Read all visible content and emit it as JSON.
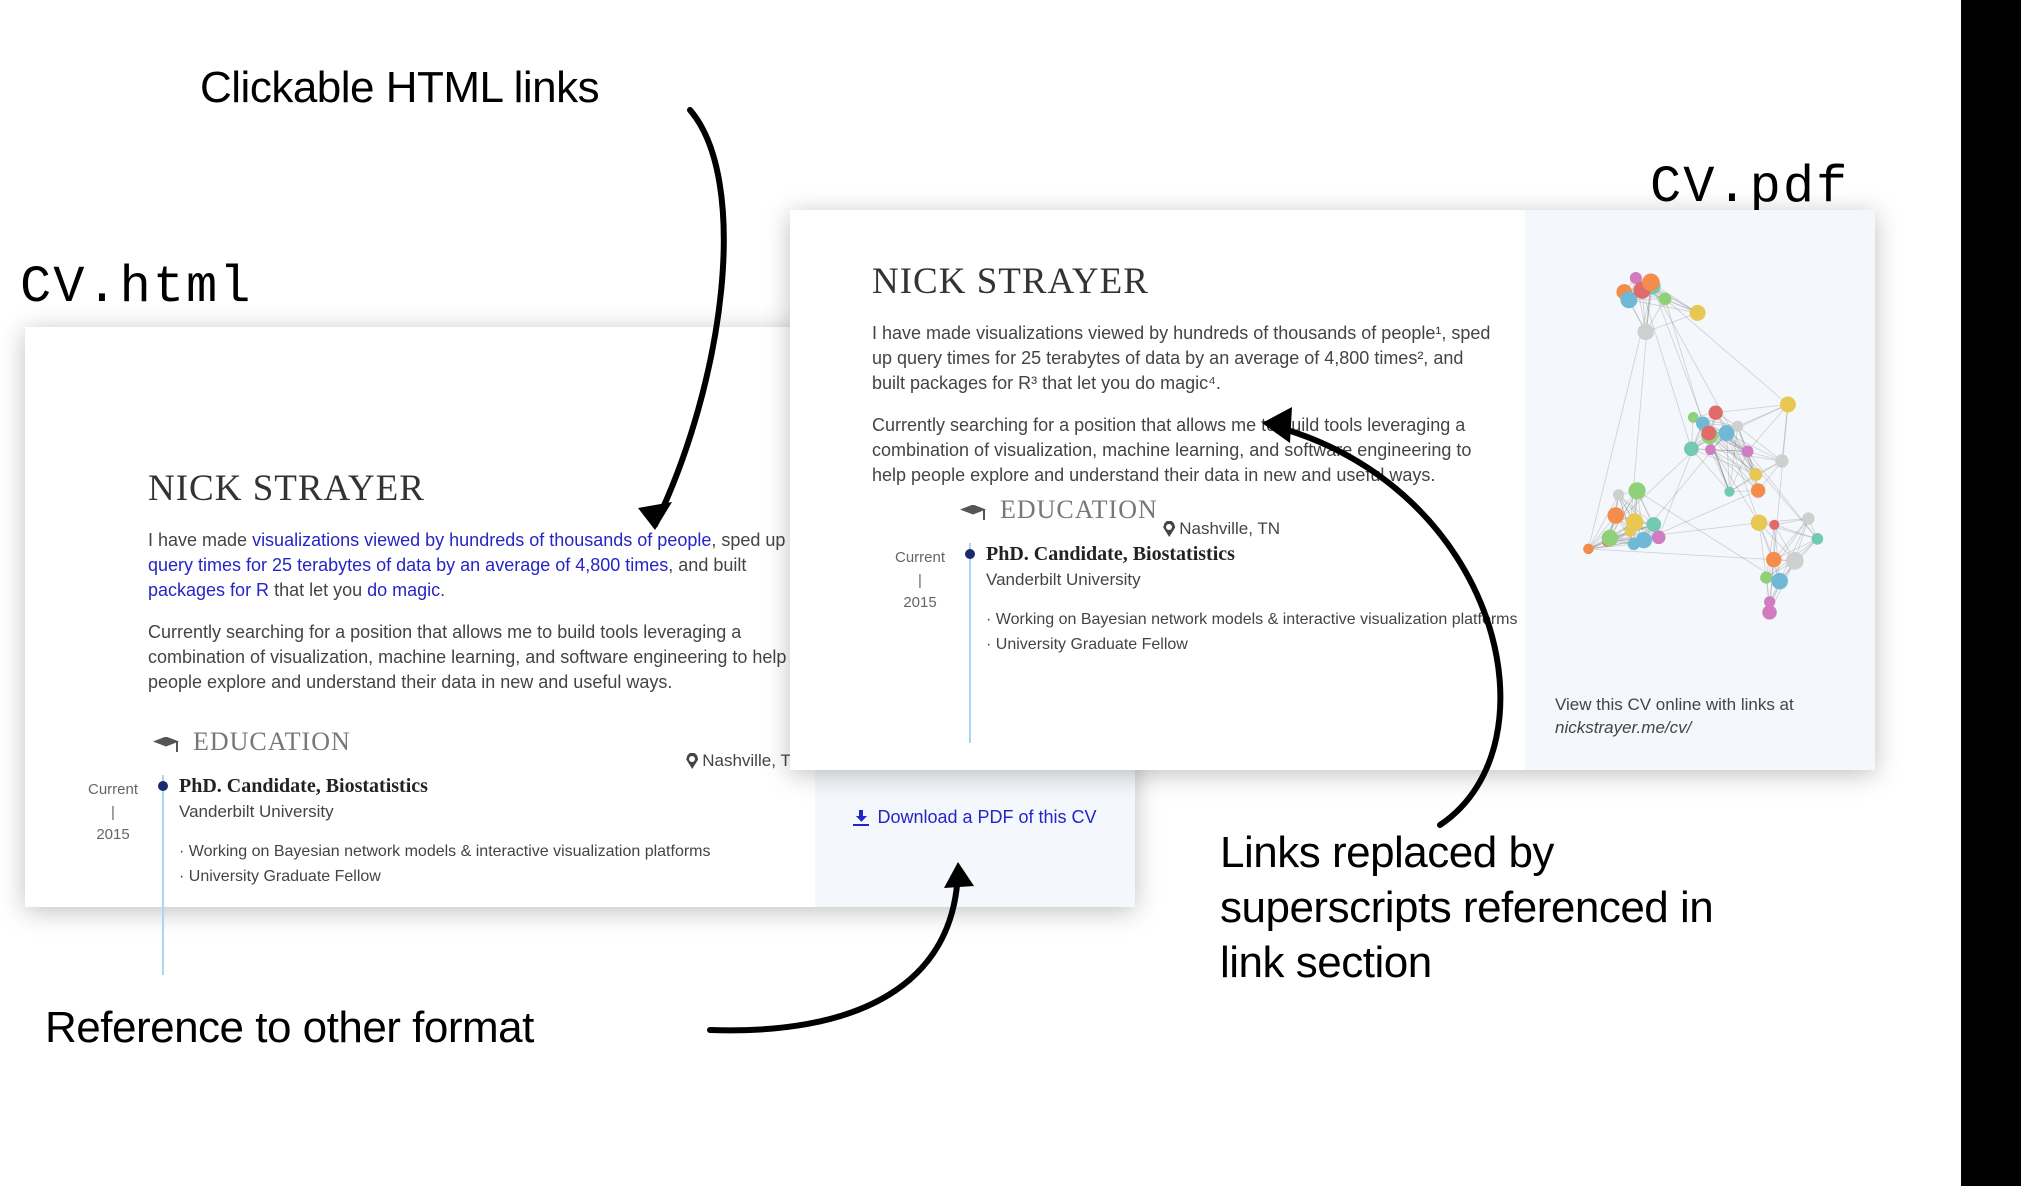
{
  "annotations": {
    "clickable": "Clickable HTML links",
    "refFormat": "Reference to other format",
    "supers": "Links replaced by superscripts referenced in link section",
    "labelHtml": "CV.html",
    "labelPdf": "CV.pdf"
  },
  "cv": {
    "name": "NICK STRAYER",
    "introHtml": {
      "pre": "I have made ",
      "link1": "visualizations viewed by hundreds of thousands of people",
      "mid1": ", sped up ",
      "link2": "query times for 25 terabytes of data by an average of 4,800 times",
      "mid2": ", and built ",
      "link3": "packages for R",
      "mid3": " that let you ",
      "link4": "do magic",
      "post": "."
    },
    "introPdf": "I have made visualizations viewed by hundreds of thousands of people¹, sped up query times for 25 terabytes of data by an average of 4,800 times², and built packages for R³ that let you do magic⁴.",
    "blurb": "Currently searching for a position that allows me to build tools leveraging a combination of visualization, machine learning, and software engineering to help people explore and understand their data in new and useful ways.",
    "section": "EDUCATION",
    "dateTop": "Current",
    "datePipe": "|",
    "dateBottom": "2015",
    "eduTitle": "PhD. Candidate, Biostatistics",
    "eduSub": "Vanderbilt University",
    "eduLoc": "Nashville, TN",
    "bul1": "Working on Bayesian network models & interactive visualization platforms",
    "bul2": "University Graduate Fellow",
    "download": "Download a PDF of this CV",
    "viewOnline": "View this CV online with links at ",
    "viewUrl": "nickstrayer.me/cv/"
  }
}
